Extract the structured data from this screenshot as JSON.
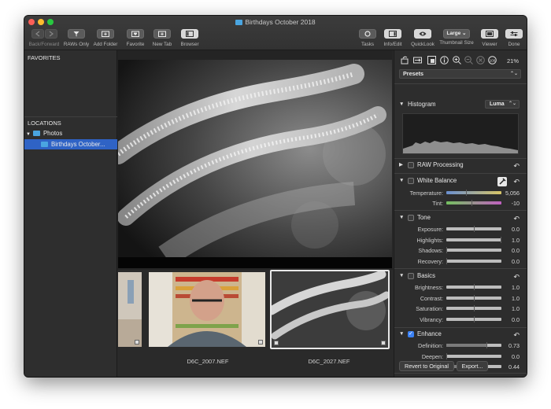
{
  "window": {
    "title": "Birthdays October 2018"
  },
  "toolbar": {
    "back_forward": "Back/Forward",
    "raws_only": "RAWs Only",
    "add_folder": "Add Folder",
    "favorite": "Favorite",
    "new_tab": "New Tab",
    "browser": "Browser",
    "tasks": "Tasks",
    "info_edit": "Info/Edit",
    "quicklook": "QuickLook",
    "thumb_size_value": "Large",
    "thumb_size": "Thumbnail Size",
    "viewer": "Viewer",
    "done": "Done"
  },
  "sidebar": {
    "favorites": "FAVORITES",
    "locations": "LOCATIONS",
    "photos": "Photos",
    "selected_folder": "Birthdays October..."
  },
  "filmstrip": {
    "items": [
      {
        "name": "D6C_2007.NEF"
      },
      {
        "name": "D6C_2027.NEF"
      }
    ]
  },
  "inspector": {
    "zoom": "21%",
    "presets": "Presets",
    "histogram": {
      "title": "Histogram",
      "mode": "Luma"
    },
    "raw_processing": {
      "title": "RAW Processing"
    },
    "white_balance": {
      "title": "White Balance",
      "temperature_label": "Temperature:",
      "temperature": "5,056",
      "temperature_pos": 0.36,
      "tint_label": "Tint:",
      "tint": "-10",
      "tint_pos": 0.45
    },
    "tone": {
      "title": "Tone",
      "rows": [
        {
          "label": "Exposure:",
          "value": "0.0",
          "pos": 0.5
        },
        {
          "label": "Highlights:",
          "value": "1.0",
          "pos": 1.0
        },
        {
          "label": "Shadows:",
          "value": "0.0",
          "pos": 0.0
        },
        {
          "label": "Recovery:",
          "value": "0.0",
          "pos": 0.0
        }
      ]
    },
    "basics": {
      "title": "Basics",
      "rows": [
        {
          "label": "Brightness:",
          "value": "1.0",
          "pos": 0.5
        },
        {
          "label": "Contrast:",
          "value": "1.0",
          "pos": 0.5
        },
        {
          "label": "Saturation:",
          "value": "1.0",
          "pos": 0.5
        },
        {
          "label": "Vibrancy:",
          "value": "0.0",
          "pos": 0.5
        }
      ]
    },
    "enhance": {
      "title": "Enhance",
      "rows": [
        {
          "label": "Definition:",
          "value": "0.73",
          "pos": 0.73
        },
        {
          "label": "Deepen:",
          "value": "0.0",
          "pos": 0.0
        },
        {
          "label": "Lighten:",
          "value": "0.44",
          "pos": 0.44
        }
      ]
    },
    "revert": "Revert to Original",
    "export": "Export..."
  }
}
